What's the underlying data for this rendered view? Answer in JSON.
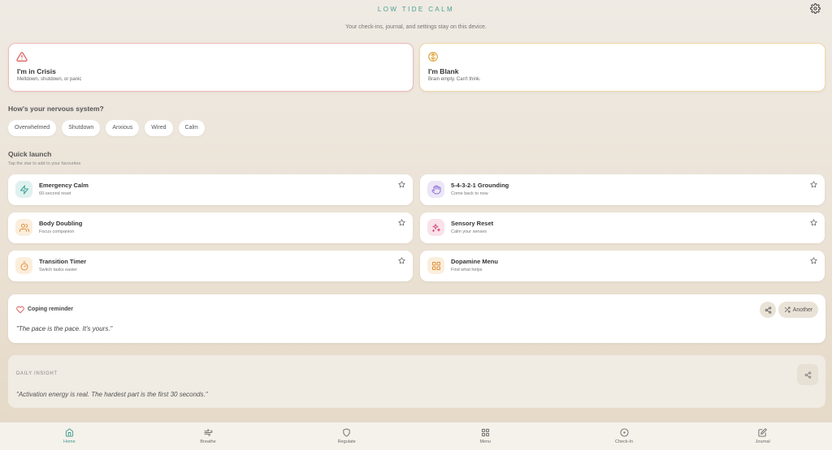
{
  "app": {
    "title": "LOW TIDE CALM",
    "privacy_note": "Your check-ins, journal, and settings stay on this device."
  },
  "crisis_cards": [
    {
      "title": "I'm in Crisis",
      "subtitle": "Meltdown, shutdown, or panic",
      "icon": "warning-icon",
      "color": "#d9544f"
    },
    {
      "title": "I'm Blank",
      "subtitle": "Brain empty. Can't think.",
      "icon": "brain-icon",
      "color": "#e0a23c"
    }
  ],
  "nervous": {
    "heading": "How's your nervous system?",
    "chips": [
      "Overwhelmed",
      "Shutdown",
      "Anxious",
      "Wired",
      "Calm"
    ]
  },
  "quick_launch": {
    "heading": "Quick launch",
    "subheading": "Tap the star to add to your favourites",
    "items": [
      {
        "title": "Emergency Calm",
        "subtitle": "60-second reset",
        "icon": "lightning-icon",
        "color": "#3aa394",
        "bg": "#dff1ee"
      },
      {
        "title": "5-4-3-2-1 Grounding",
        "subtitle": "Come back to now",
        "icon": "hand-icon",
        "color": "#8c6fd0",
        "bg": "#ece6f7"
      },
      {
        "title": "Body Doubling",
        "subtitle": "Focus companion",
        "icon": "people-icon",
        "color": "#e0913a",
        "bg": "#fbeedd"
      },
      {
        "title": "Sensory Reset",
        "subtitle": "Calm your senses",
        "icon": "sparkle-icon",
        "color": "#d6537d",
        "bg": "#f9e2ea"
      },
      {
        "title": "Transition Timer",
        "subtitle": "Switch tasks easier",
        "icon": "timer-icon",
        "color": "#e0913a",
        "bg": "#fbeedd"
      },
      {
        "title": "Dopamine Menu",
        "subtitle": "Find what helps",
        "icon": "grid-icon",
        "color": "#e0913a",
        "bg": "#fbeedd"
      }
    ]
  },
  "coping": {
    "label": "Coping reminder",
    "quote": "\"The pace is the pace. It's yours.\"",
    "another_label": "Another",
    "accent": "#d9544f"
  },
  "insight": {
    "label": "DAILY INSIGHT",
    "quote": "\"Activation energy is real. The hardest part is the first 30 seconds.\""
  },
  "nav": [
    {
      "label": "Home",
      "icon": "home-icon",
      "active": true
    },
    {
      "label": "Breathe",
      "icon": "wind-icon",
      "active": false
    },
    {
      "label": "Regulate",
      "icon": "shield-icon",
      "active": false
    },
    {
      "label": "Menu",
      "icon": "grid-icon",
      "active": false
    },
    {
      "label": "Check-In",
      "icon": "checkin-icon",
      "active": false
    },
    {
      "label": "Journal",
      "icon": "journal-icon",
      "active": false
    }
  ],
  "colors": {
    "accent": "#3e9c8e"
  }
}
